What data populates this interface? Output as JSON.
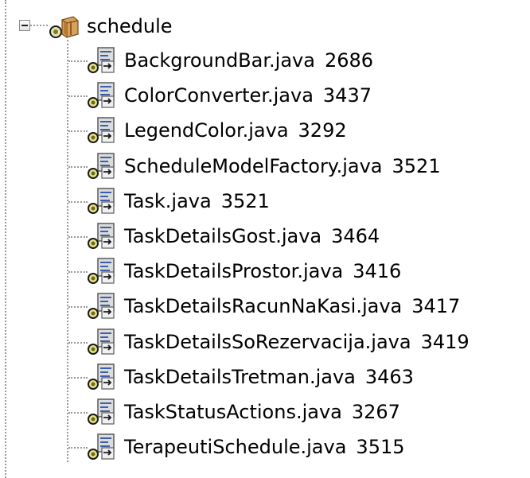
{
  "tree": {
    "root": {
      "label": "schedule",
      "expanded": true,
      "icon": "package-icon"
    },
    "files": [
      {
        "name": "BackgroundBar.java",
        "size": "2686",
        "icon": "java-class-icon"
      },
      {
        "name": "ColorConverter.java",
        "size": "3437",
        "icon": "java-class-icon"
      },
      {
        "name": "LegendColor.java",
        "size": "3292",
        "icon": "java-class-icon"
      },
      {
        "name": "ScheduleModelFactory.java",
        "size": "3521",
        "icon": "java-class-icon"
      },
      {
        "name": "Task.java",
        "size": "3521",
        "icon": "java-class-icon"
      },
      {
        "name": "TaskDetailsGost.java",
        "size": "3464",
        "icon": "java-class-icon"
      },
      {
        "name": "TaskDetailsProstor.java",
        "size": "3416",
        "icon": "java-class-icon"
      },
      {
        "name": "TaskDetailsRacunNaKasi.java",
        "size": "3417",
        "icon": "java-class-icon"
      },
      {
        "name": "TaskDetailsSoRezervacija.java",
        "size": "3419",
        "icon": "java-class-icon"
      },
      {
        "name": "TaskDetailsTretman.java",
        "size": "3463",
        "icon": "java-class-icon"
      },
      {
        "name": "TaskStatusActions.java",
        "size": "3267",
        "icon": "java-class-icon"
      },
      {
        "name": "TerapeutiSchedule.java",
        "size": "3515",
        "icon": "java-class-icon"
      }
    ]
  },
  "colors": {
    "connector": "#9a9a9a",
    "text": "#000000",
    "background": "#ffffff"
  }
}
